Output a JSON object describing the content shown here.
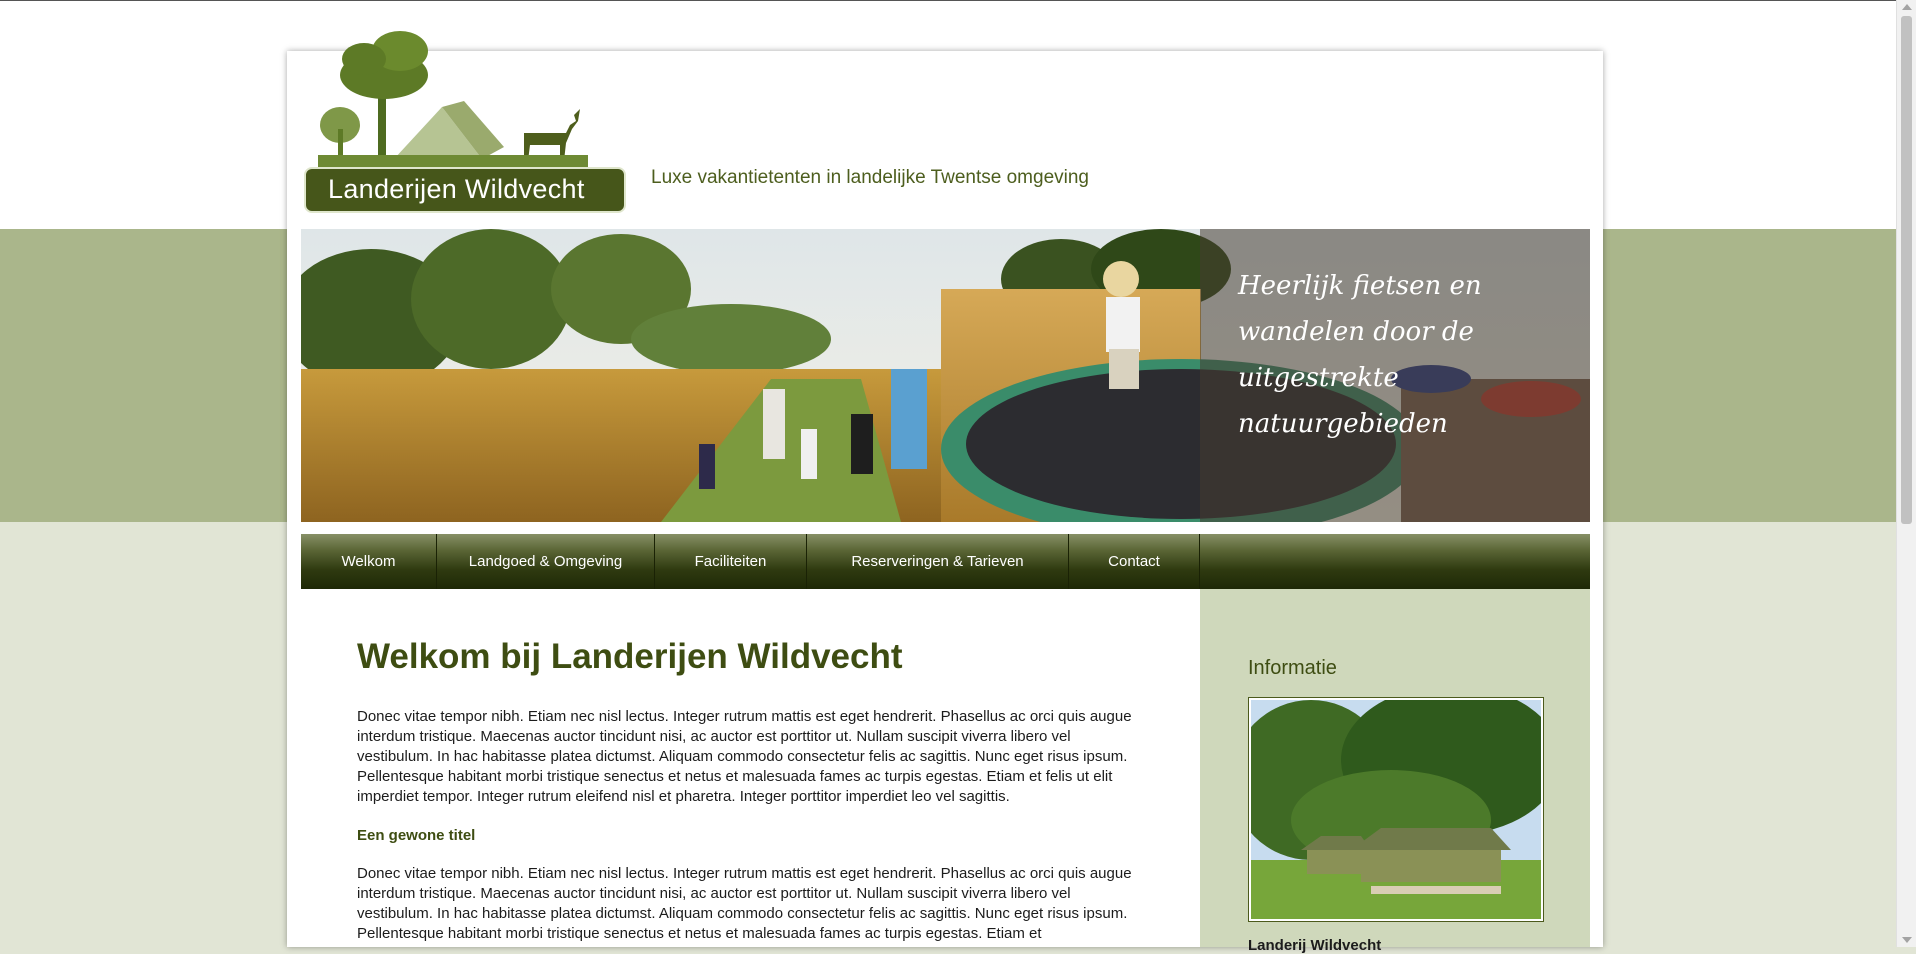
{
  "site": {
    "logo_text": "Landerijen Wildvecht",
    "tagline": "Luxe vakantietenten in landelijke Twentse omgeving"
  },
  "banner": {
    "caption": "Heerlijk fietsen en wandelen door de uitgestrekte natuurgebieden"
  },
  "nav": {
    "items": [
      {
        "label": "Welkom"
      },
      {
        "label": "Landgoed & Omgeving"
      },
      {
        "label": "Faciliteiten"
      },
      {
        "label": "Reserveringen & Tarieven"
      },
      {
        "label": "Contact"
      }
    ]
  },
  "main": {
    "title": "Welkom bij Landerijen Wildvecht",
    "paragraph1": "Donec vitae tempor nibh. Etiam nec nisl lectus. Integer rutrum mattis est eget hendrerit. Phasellus ac orci quis augue interdum tristique. Maecenas auctor tincidunt nisi, ac auctor est porttitor ut. Nullam suscipit viverra libero vel vestibulum. In hac habitasse platea dictumst. Aliquam commodo consectetur felis ac sagittis. Nunc eget risus ipsum. Pellentesque habitant morbi tristique senectus et netus et malesuada fames ac turpis egestas. Etiam et felis ut elit imperdiet tempor. Integer rutrum eleifend nisl et pharetra. Integer porttitor imperdiet leo vel sagittis.",
    "subheading": "Een gewone titel",
    "paragraph2": "Donec vitae tempor nibh. Etiam nec nisl lectus. Integer rutrum mattis est eget hendrerit. Phasellus ac orci quis augue interdum tristique. Maecenas auctor tincidunt nisi, ac auctor est porttitor ut. Nullam suscipit viverra libero vel vestibulum. In hac habitasse platea dictumst. Aliquam commodo consectetur felis ac sagittis. Nunc eget risus ipsum. Pellentesque habitant morbi tristique senectus et netus et malesuada fames ac turpis egestas. Etiam et"
  },
  "sidebar": {
    "title": "Informatie",
    "caption": "Landerij Wildvecht"
  },
  "colors": {
    "brand_dark": "#46561a",
    "band_green": "#aab68b",
    "page_bg": "#e1e5d5",
    "sidebar_bg": "#cfd8bb"
  }
}
